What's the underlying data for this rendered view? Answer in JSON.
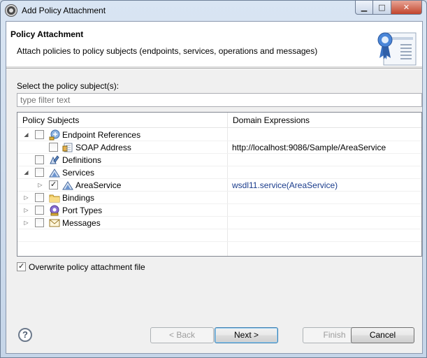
{
  "window": {
    "title": "Add Policy Attachment",
    "buttons": {
      "minimize": "▁",
      "maximize": "□",
      "close": "✕"
    }
  },
  "header": {
    "title": "Policy Attachment",
    "description": "Attach policies to policy subjects (endpoints, services, operations and messages)"
  },
  "selector": {
    "label": "Select the policy subject(s):",
    "filter_placeholder": "type filter text"
  },
  "table": {
    "columns": [
      "Policy Subjects",
      "Domain Expressions"
    ],
    "rows": [
      {
        "label": "Endpoint References",
        "expression": "",
        "expanded": true,
        "checked": false,
        "icon": "endpoint-icon"
      },
      {
        "label": "SOAP Address",
        "expression": "http://localhost:9086/Sample/AreaService",
        "checked": false,
        "icon": "soap-address-icon"
      },
      {
        "label": "Definitions",
        "expression": "",
        "checked": false,
        "icon": "definitions-icon"
      },
      {
        "label": "Services",
        "expression": "",
        "expanded": true,
        "checked": false,
        "icon": "services-icon"
      },
      {
        "label": "AreaService",
        "expression": "wsdl11.service(AreaService)",
        "expanded": false,
        "checked": true,
        "icon": "service-icon"
      },
      {
        "label": "Bindings",
        "expression": "",
        "expanded": false,
        "checked": false,
        "icon": "folder-icon"
      },
      {
        "label": "Port Types",
        "expression": "",
        "expanded": false,
        "checked": false,
        "icon": "port-types-icon"
      },
      {
        "label": "Messages",
        "expression": "",
        "expanded": false,
        "checked": false,
        "icon": "messages-icon"
      }
    ]
  },
  "overwrite": {
    "label": "Overwrite policy attachment file",
    "checked": true
  },
  "buttons": {
    "help": "?",
    "back": "< Back",
    "next": "Next >",
    "finish": "Finish",
    "cancel": "Cancel"
  },
  "colors": {
    "expression_link": "#1a3c8c",
    "accent": "#3c7fb1"
  }
}
